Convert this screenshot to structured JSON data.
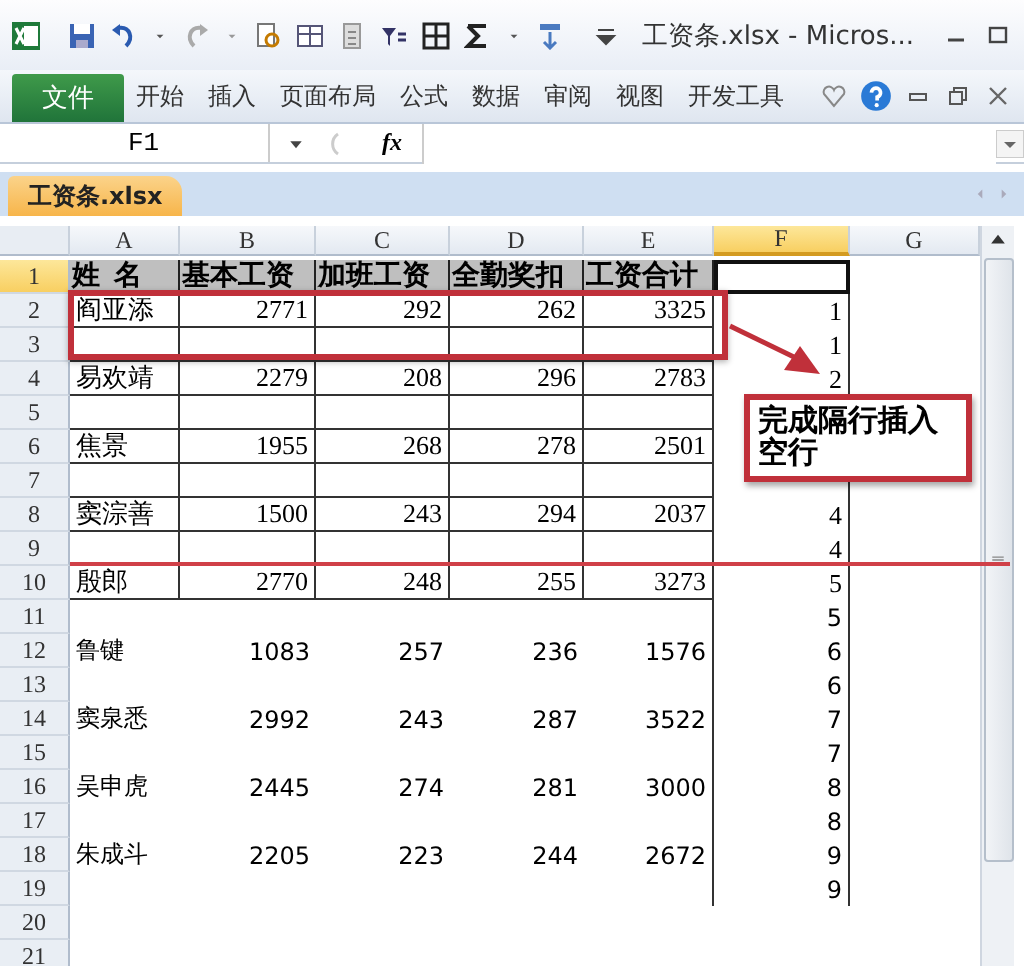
{
  "title_bar": {
    "title": "工资条.xlsx - Micros..."
  },
  "ribbon": {
    "tabs": [
      {
        "label": "文件",
        "kind": "file"
      },
      {
        "label": "开始",
        "kind": "tab"
      },
      {
        "label": "插入",
        "kind": "tab"
      },
      {
        "label": "页面布局",
        "kind": "tab"
      },
      {
        "label": "公式",
        "kind": "tab"
      },
      {
        "label": "数据",
        "kind": "tab"
      },
      {
        "label": "审阅",
        "kind": "tab"
      },
      {
        "label": "视图",
        "kind": "tab"
      },
      {
        "label": "开发工具",
        "kind": "tab"
      }
    ]
  },
  "formula_bar": {
    "name_box": "F1",
    "fx": "fx"
  },
  "sheet_tabs": [
    {
      "label": "工资条.xlsx",
      "selected": true
    }
  ],
  "sheet": {
    "columns": [
      {
        "label": "A",
        "selected": false
      },
      {
        "label": "B",
        "selected": false
      },
      {
        "label": "C",
        "selected": false
      },
      {
        "label": "D",
        "selected": false
      },
      {
        "label": "E",
        "selected": false
      },
      {
        "label": "F",
        "selected": true
      },
      {
        "label": "G",
        "selected": false
      }
    ],
    "rows": [
      {
        "number": "1",
        "selected": true,
        "kind": "header",
        "cells": {
          "A": "姓  名",
          "B": "基本工资",
          "C": "加班工资",
          "D": "全勤奖扣",
          "E": "工资合计"
        }
      },
      {
        "number": "2",
        "selected": false,
        "kind": "bordered",
        "cells": {
          "A": "阎亚添",
          "B": "2771",
          "C": "292",
          "D": "262",
          "E": "3325",
          "F": "1"
        }
      },
      {
        "number": "3",
        "selected": false,
        "kind": "bordered",
        "cells": {
          "F": "1"
        }
      },
      {
        "number": "4",
        "selected": false,
        "kind": "bordered",
        "cells": {
          "A": "易欢靖",
          "B": "2279",
          "C": "208",
          "D": "296",
          "E": "2783",
          "F": "2"
        }
      },
      {
        "number": "5",
        "selected": false,
        "kind": "bordered",
        "cells": {}
      },
      {
        "number": "6",
        "selected": false,
        "kind": "bordered",
        "cells": {
          "A": "焦景",
          "B": "1955",
          "C": "268",
          "D": "278",
          "E": "2501"
        }
      },
      {
        "number": "7",
        "selected": false,
        "kind": "bordered",
        "cells": {}
      },
      {
        "number": "8",
        "selected": false,
        "kind": "bordered",
        "cells": {
          "A": "窦淙善",
          "B": "1500",
          "C": "243",
          "D": "294",
          "E": "2037",
          "F": "4"
        }
      },
      {
        "number": "9",
        "selected": false,
        "kind": "bordered",
        "cells": {
          "F": "4"
        }
      },
      {
        "number": "10",
        "selected": false,
        "kind": "bordered",
        "cells": {
          "A": "殷郎",
          "B": "2770",
          "C": "248",
          "D": "255",
          "E": "3273",
          "F": "5"
        }
      },
      {
        "number": "11",
        "selected": false,
        "kind": "plain",
        "cells": {
          "F": "5"
        }
      },
      {
        "number": "12",
        "selected": false,
        "kind": "plain",
        "cells": {
          "A": "鲁键",
          "B": "1083",
          "C": "257",
          "D": "236",
          "E": "1576",
          "F": "6"
        }
      },
      {
        "number": "13",
        "selected": false,
        "kind": "plain",
        "cells": {
          "F": "6"
        }
      },
      {
        "number": "14",
        "selected": false,
        "kind": "plain",
        "cells": {
          "A": "窦泉悉",
          "B": "2992",
          "C": "243",
          "D": "287",
          "E": "3522",
          "F": "7"
        }
      },
      {
        "number": "15",
        "selected": false,
        "kind": "plain",
        "cells": {
          "F": "7"
        }
      },
      {
        "number": "16",
        "selected": false,
        "kind": "plain",
        "cells": {
          "A": "吴申虎",
          "B": "2445",
          "C": "274",
          "D": "281",
          "E": "3000",
          "F": "8"
        }
      },
      {
        "number": "17",
        "selected": false,
        "kind": "plain",
        "cells": {
          "F": "8"
        }
      },
      {
        "number": "18",
        "selected": false,
        "kind": "plain",
        "cells": {
          "A": "朱成斗",
          "B": "2205",
          "C": "223",
          "D": "244",
          "E": "2672",
          "F": "9"
        }
      },
      {
        "number": "19",
        "selected": false,
        "kind": "plain",
        "cells": {
          "F": "9"
        }
      },
      {
        "number": "20",
        "selected": false,
        "kind": "empty",
        "cells": {}
      },
      {
        "number": "21",
        "selected": false,
        "kind": "empty",
        "cells": {}
      }
    ]
  },
  "callout": {
    "text": "完成隔行插入空行"
  }
}
